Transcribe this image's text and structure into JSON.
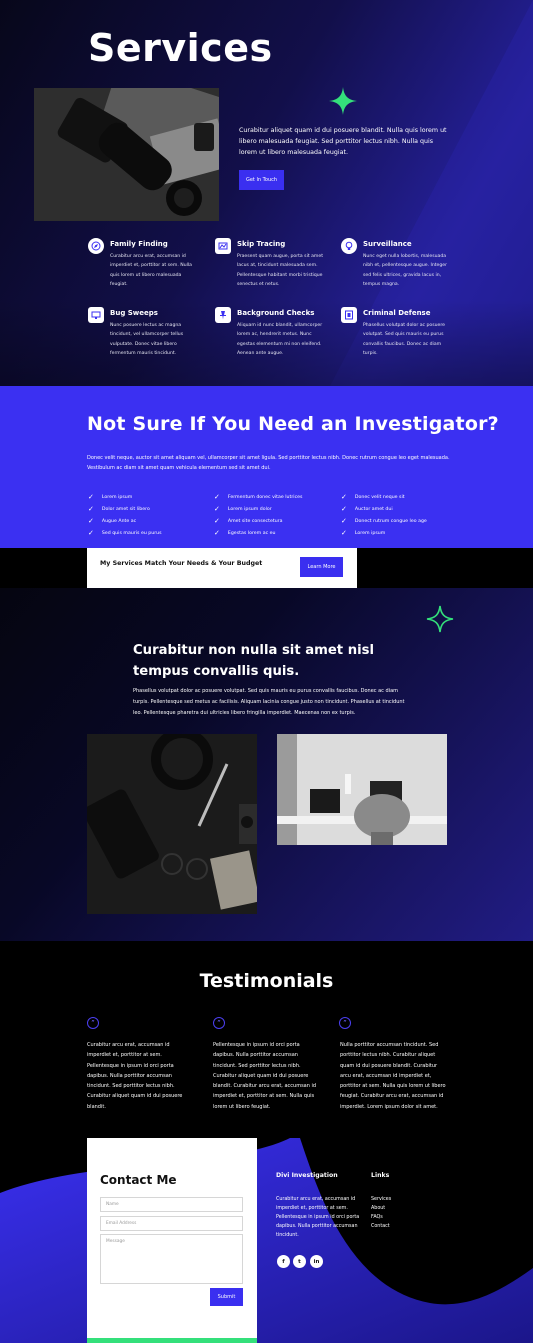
{
  "hero": {
    "title": "Services",
    "text": "Curabitur aliquet quam id dui posuere blandit. Nulla quis lorem ut libero malesuada feugiat. Sed porttitor lectus nibh. Nulla quis lorem ut libero malesuada feugiat.",
    "button": "Get In Touch"
  },
  "services": [
    {
      "title": "Family Finding",
      "icon": "compass-icon",
      "text": "Curabitur arcu erat, accumsan id imperdiet et, porttitor at sem. Nulla quis lorem ut libero malesuada feugiat."
    },
    {
      "title": "Skip Tracing",
      "icon": "map-icon",
      "text": "Praesent quam augue, porta sit amet lacus at, tincidunt malesuada sem. Pellentesque habitant morbi tristique senectus et netus."
    },
    {
      "title": "Surveillance",
      "icon": "lightbulb-icon",
      "text": "Nunc eget nulla lobortis, malesuada nibh et, pellentesque augue. Integer sed felis ultrices, gravida lacus in, tempus magna."
    },
    {
      "title": "Bug Sweeps",
      "icon": "monitor-icon",
      "text": "Nunc posuere lectus ac magna tincidunt, vel ullamcorper tellus vulputate. Donec vitae libero fermentum mauris tincidunt."
    },
    {
      "title": "Background Checks",
      "icon": "pushpin-icon",
      "text": "Aliquam id nunc blandit, ullamcorper lorem ac, hendrerit metus. Nunc egestas elementum mi non eleifend. Aenean ante augue."
    },
    {
      "title": "Criminal Defense",
      "icon": "film-icon",
      "text": "Phasellus volutpat dolor ac posuere volutpat. Sed quis mauris eu purus convallis faucibus. Donec ac diam turpis."
    }
  ],
  "band": {
    "title": "Not Sure If You Need an Investigator?",
    "text": "Donec velit neque, auctor sit amet aliquam vel, ullamcorper sit amet ligula. Sed porttitor lectus nibh. Donec rutrum congue leo eget malesuada. Vestibulum ac diam sit amet quam vehicula elementum sed sit amet dui.",
    "checks_col1": [
      "Lorem ipsum",
      "Dolor amet sit libero",
      "Augue Ante ac",
      "Sed quis mauris eu purus"
    ],
    "checks_col2": [
      "Fermentum donec vitae lutrices",
      "Lorem ipsum dolor",
      "Amet site consectetura",
      "Egestas lorem ac eu"
    ],
    "checks_col3": [
      "Donec velit neque sit",
      "Auctor amet dui",
      "Donect rutrum congue leo age",
      "Lorem ipsum"
    ]
  },
  "cta": {
    "text": "My Services Match Your Needs & Your Budget",
    "button": "Learn More"
  },
  "section3": {
    "title": "Curabitur non nulla sit amet nisl tempus convallis quis.",
    "text": "Phasellus volutpat dolor ac posuere volutpat. Sed quis mauris eu purus convallis faucibus. Donec ac diam turpis. Pellentesque sed metus ac facilisis. Aliquam lacinia congue justo non tincidunt. Phasellus at tincidunt leo. Pellentesque pharetra dui ultricies libero fringilla imperdiet. Maecenas non ex turpis."
  },
  "testimonials": {
    "title": "Testimonials",
    "items": [
      "Curabitur arcu erat, accumsan id imperdiet et, porttitor at sem. Pellentesque in ipsum id orci porta dapibus. Nulla porttitor accumsan tincidunt. Sed porttitor lectus nibh. Curabitur aliquet quam id dui posuere blandit.",
      "Pellentesque in ipsum id orci porta dapibus. Nulla porttitor accumsan tincidunt. Sed porttitor lectus nibh. Curabitur aliquet quam id dui posuere blandit. Curabitur arcu erat, accumsan id imperdiet et, porttitor at sem. Nulla quis lorem ut libero feugiat.",
      "Nulla porttitor accumsan tincidunt. Sed porttitor lectus nibh. Curabitur aliquet quam id dui posuere blandit. Curabitur arcu erat, accumsan id imperdiet et, porttitor at sem. Nulla quis lorem ut libero feugiat. Curabitur arcu erat, accumsan id imperdiet. Lorem ipsum dolor sit amet."
    ]
  },
  "contact": {
    "title": "Contact Me",
    "name_placeholder": "Name",
    "email_placeholder": "Email Address",
    "message_placeholder": "Message",
    "submit": "Submit"
  },
  "footer": {
    "brand_title": "Divi Investigation",
    "brand_text": "Curabitur arcu erat, accumsan id imperdiet et, porttitor at sem. Pellentesque in ipsum id orci porta dapibus. Nulla porttitor accumsan tincidunt.",
    "links_title": "Links",
    "links": [
      "Services",
      "About",
      "FAQs",
      "Contact"
    ],
    "social": [
      {
        "icon": "facebook-icon",
        "glyph": "f"
      },
      {
        "icon": "twitter-icon",
        "glyph": "t"
      },
      {
        "icon": "linkedin-icon",
        "glyph": "in"
      }
    ]
  },
  "colors": {
    "accent": "#3b30f2",
    "green_accent": "#34e07b",
    "dark": "#000000"
  }
}
